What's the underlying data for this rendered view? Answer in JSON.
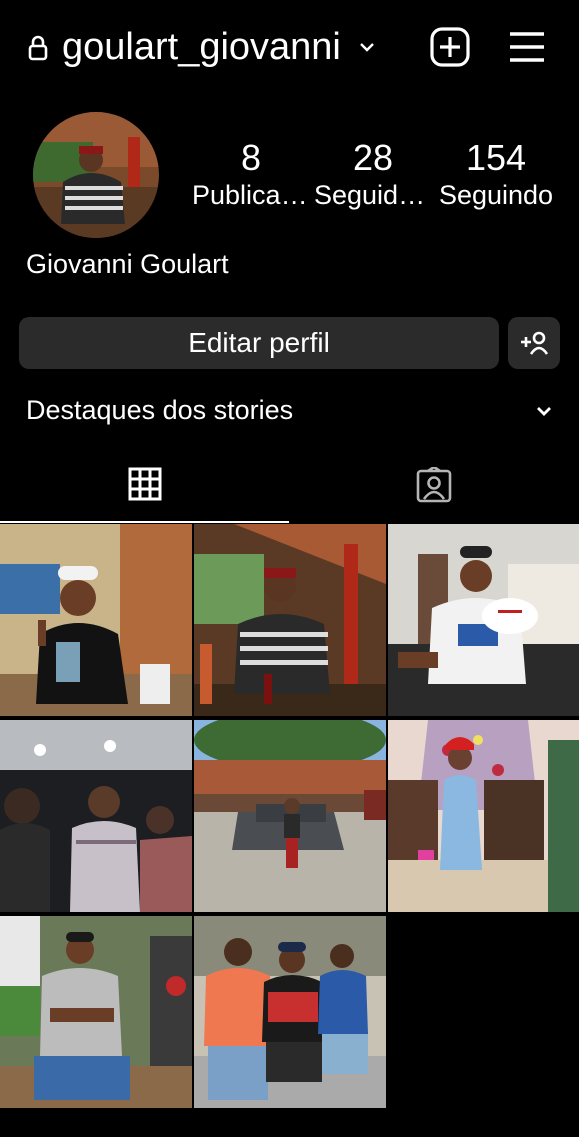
{
  "header": {
    "username": "goulart_giovanni",
    "icons": {
      "lock": "lock-icon",
      "chevron": "chevron-down-icon",
      "create": "plus-square-icon",
      "menu": "hamburger-menu-icon"
    }
  },
  "profile": {
    "full_name": "Giovanni Goulart",
    "stats": [
      {
        "count": "8",
        "label": "Publicações"
      },
      {
        "count": "28",
        "label": "Seguidores"
      },
      {
        "count": "154",
        "label": "Seguindo"
      }
    ]
  },
  "actions": {
    "edit_profile_label": "Editar perfil",
    "add_user_icon": "add-person-icon"
  },
  "highlights": {
    "label": "Destaques dos stories"
  },
  "tabs": [
    {
      "icon": "grid-icon",
      "active": true
    },
    {
      "icon": "tagged-person-icon",
      "active": false
    }
  ],
  "posts": [
    {
      "subject": "man-white-cap-thumbs-up"
    },
    {
      "subject": "man-striped-shirt-restaurant"
    },
    {
      "subject": "man-blood-donation-sign"
    },
    {
      "subject": "group-dark-party"
    },
    {
      "subject": "man-in-front-of-car"
    },
    {
      "subject": "girl-christmas-hat"
    },
    {
      "subject": "man-arms-crossed-christmas"
    },
    {
      "subject": "three-men-posing"
    }
  ],
  "colors": {
    "background": "#000000",
    "button": "#2b2b2b",
    "text": "#ffffff"
  }
}
